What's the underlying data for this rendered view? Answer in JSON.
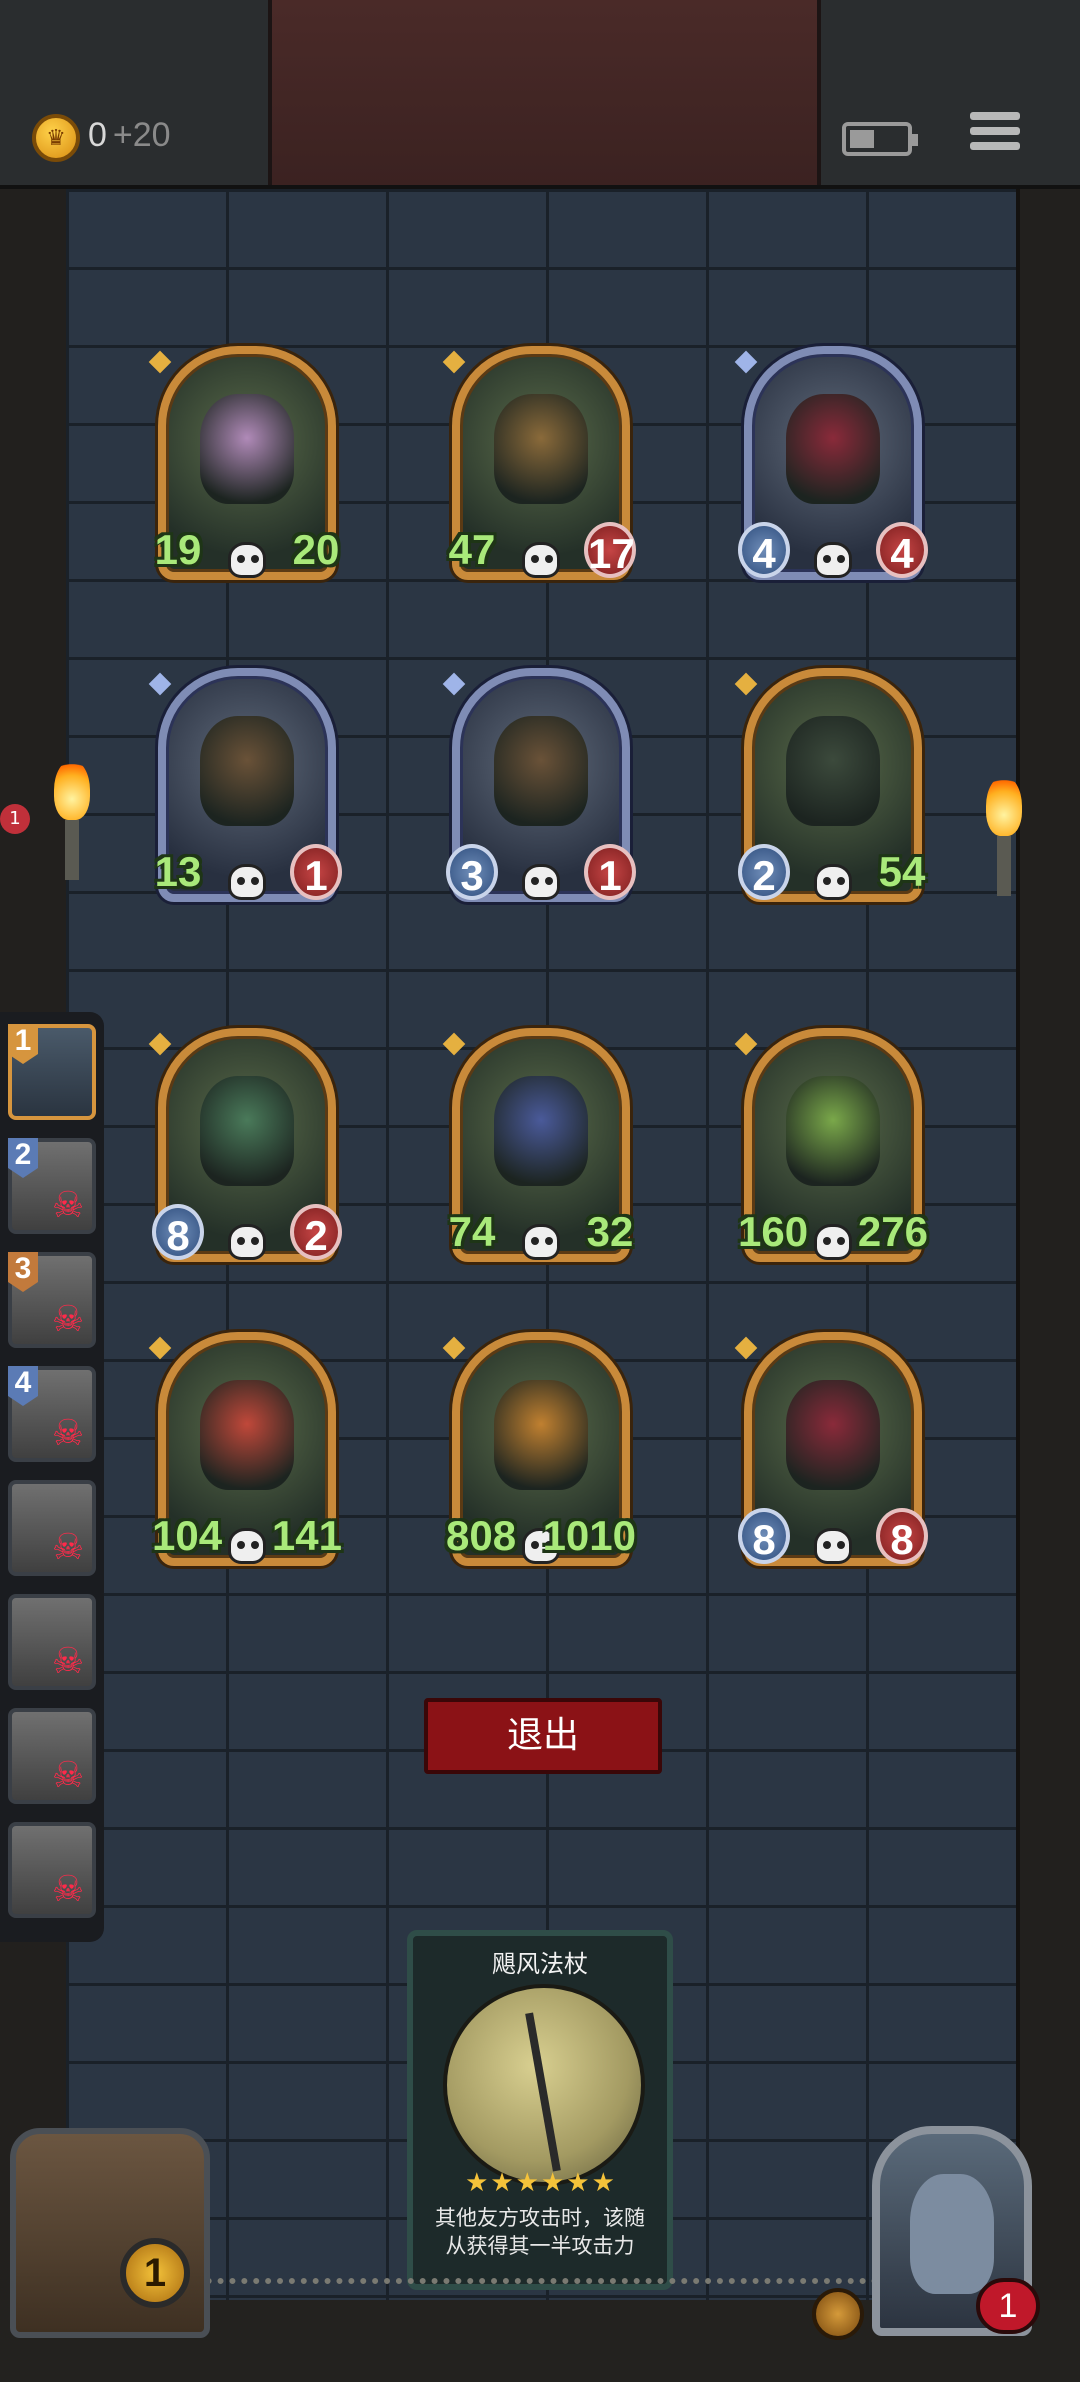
{
  "header": {
    "gold": "0",
    "gold_bonus": "+20"
  },
  "board": {
    "units": [
      {
        "atk": "19",
        "hp": "20",
        "frame": "gold",
        "atk_style": "green",
        "hp_style": "green",
        "art": "#b08ab8"
      },
      {
        "atk": "47",
        "hp": "17",
        "frame": "gold",
        "atk_style": "green",
        "hp_style": "red",
        "art": "#8a6a3a"
      },
      {
        "atk": "4",
        "hp": "4",
        "frame": "blue",
        "atk_style": "blue",
        "hp_style": "red",
        "art": "#8a2a3a"
      },
      {
        "atk": "13",
        "hp": "1",
        "frame": "blue",
        "atk_style": "green",
        "hp_style": "red",
        "art": "#6a5238"
      },
      {
        "atk": "3",
        "hp": "1",
        "frame": "blue",
        "atk_style": "blue",
        "hp_style": "red",
        "art": "#6a5238"
      },
      {
        "atk": "2",
        "hp": "54",
        "frame": "gold",
        "atk_style": "blue",
        "hp_style": "green",
        "art": "#3c4a3c"
      },
      {
        "atk": "8",
        "hp": "2",
        "frame": "gold",
        "atk_style": "blue",
        "hp_style": "red",
        "art": "#4a7a5a"
      },
      {
        "atk": "74",
        "hp": "32",
        "frame": "gold",
        "atk_style": "green",
        "hp_style": "green",
        "art": "#4a5a9a"
      },
      {
        "atk": "160",
        "hp": "276",
        "frame": "gold",
        "atk_style": "green",
        "hp_style": "green",
        "art": "#7aa84a"
      },
      {
        "atk": "104",
        "hp": "141",
        "frame": "gold",
        "atk_style": "green",
        "hp_style": "green",
        "art": "#c0483a"
      },
      {
        "atk": "808",
        "hp": "1010",
        "frame": "gold",
        "atk_style": "green",
        "hp_style": "green",
        "art": "#c08030"
      },
      {
        "atk": "8",
        "hp": "8",
        "frame": "gold",
        "atk_style": "blue",
        "hp_style": "red",
        "art": "#8a2a3a"
      }
    ]
  },
  "party": {
    "slots": [
      {
        "num": "1",
        "dead": false
      },
      {
        "num": "2",
        "dead": true
      },
      {
        "num": "3",
        "dead": true
      },
      {
        "num": "4",
        "dead": true
      },
      {
        "num": "",
        "dead": true
      },
      {
        "num": "",
        "dead": true
      },
      {
        "num": "",
        "dead": true
      },
      {
        "num": "",
        "dead": true
      }
    ],
    "notification": "1"
  },
  "actions": {
    "exit_label": "退出"
  },
  "spell_card": {
    "title": "飓风法杖",
    "stars": "★★★★★★",
    "description": "其他友方攻击时，该随从获得其一半攻击力"
  },
  "footer": {
    "backpack_count": "1",
    "hero_lives": "1"
  },
  "colors": {
    "gold_frame": "#c98a3a",
    "blue_frame": "#7f8cb5",
    "exit_button": "#8b1216",
    "stat_green": "#a9e97a"
  }
}
